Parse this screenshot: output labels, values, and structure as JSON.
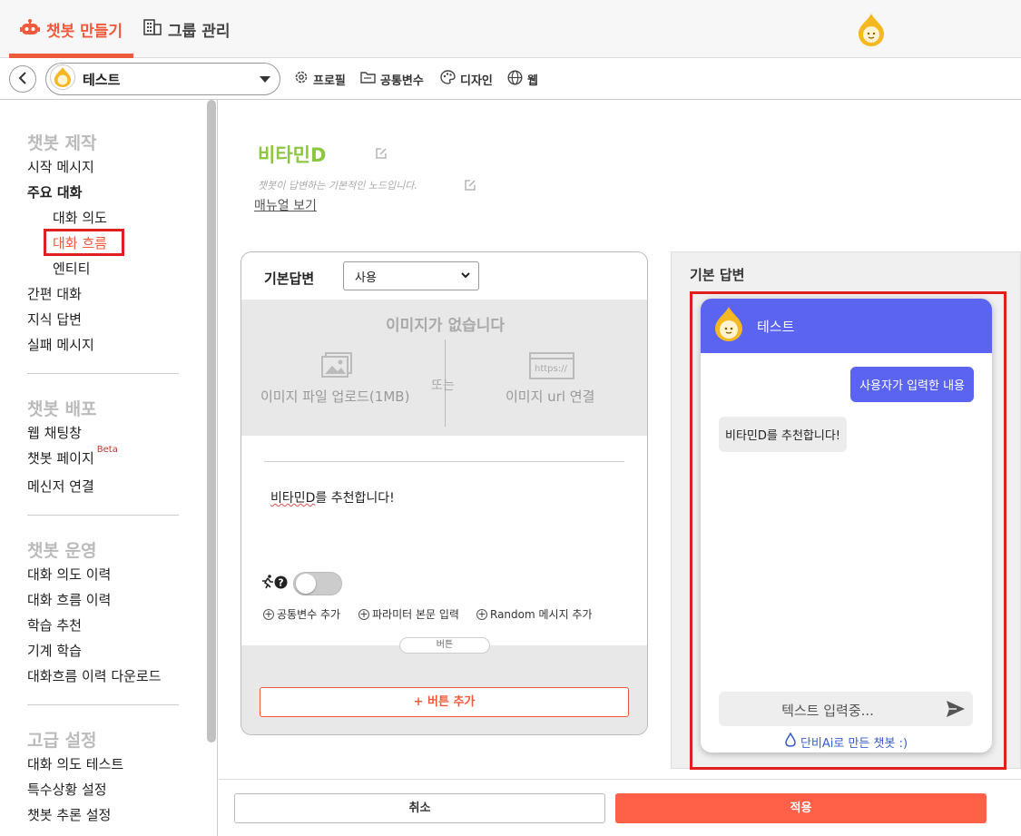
{
  "header": {
    "tabs": [
      {
        "label": "챗봇 만들기",
        "icon": "robot-icon"
      },
      {
        "label": "그룹 관리",
        "icon": "building-icon"
      }
    ],
    "accent_color": "#f05a3c"
  },
  "toolbar": {
    "bot_name": "테스트",
    "links": [
      {
        "label": "프로필",
        "icon": "gear-icon"
      },
      {
        "label": "공통변수",
        "icon": "folder-icon"
      },
      {
        "label": "디자인",
        "icon": "palette-icon"
      },
      {
        "label": "웹",
        "icon": "globe-icon"
      }
    ]
  },
  "sidebar": {
    "sections": [
      {
        "title": "챗봇 제작"
      },
      {
        "title": "챗봇 배포"
      },
      {
        "title": "챗봇 운영"
      },
      {
        "title": "고급 설정"
      }
    ],
    "items": {
      "start_message": "시작 메시지",
      "main_dialog": "주요 대화",
      "dialog_intent": "대화 의도",
      "dialog_flow": "대화 흐름",
      "entity": "엔티티",
      "simple_dialog": "간편 대화",
      "knowledge_answer": "지식 답변",
      "fail_message": "실패 메시지",
      "web_chat": "웹 채팅창",
      "bot_page": "챗봇 페이지",
      "beta": "Beta",
      "messenger": "메신저 연결",
      "intent_history": "대화 의도 이력",
      "flow_history": "대화 흐름 이력",
      "learning_reco": "학습 추천",
      "machine_learning": "기계 학습",
      "flow_download": "대화흐름 이력 다운로드",
      "intent_test": "대화 의도 테스트",
      "special_situation": "특수상황 설정",
      "inference": "챗봇 추론 설정"
    }
  },
  "node": {
    "title": "비타민D",
    "description": "챗봇이 답변하는 기본적인 노드입니다.",
    "manual_link": "매뉴얼 보기"
  },
  "answer_card": {
    "label": "기본답변",
    "use_select": "사용",
    "no_image": "이미지가 없습니다",
    "or": "또는",
    "upload_option": "이미지 파일 업로드(1MB)",
    "url_option": "이미지 url 연결",
    "url_icon_text": "https://",
    "answer_text_underlined": "비타민D",
    "answer_text_rest": "를 추천합니다!",
    "add_links": [
      "공통변수 추가",
      "파라미터 본문 입력",
      "Random 메시지 추가"
    ],
    "button_tab": "버튼",
    "add_button": "+ 버튼 추가"
  },
  "preview": {
    "label": "기본 답변",
    "chat_title": "테스트",
    "user_message": "사용자가 입력한 내용",
    "bot_message": "비타민D를 추천합니다!",
    "input_placeholder": "텍스트 입력중...",
    "powered_by": "단비Ai로 만든 챗봇 :)",
    "header_color": "#5a64f0"
  },
  "footer": {
    "cancel": "취소",
    "apply": "적용"
  }
}
